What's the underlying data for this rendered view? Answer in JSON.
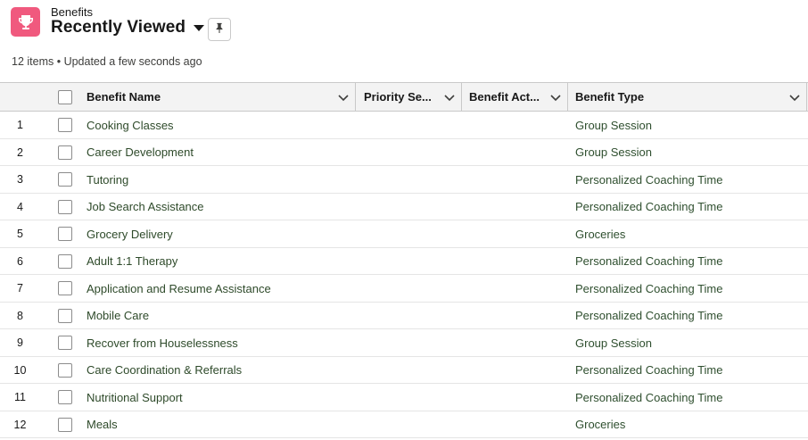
{
  "colors": {
    "icon_bg": "#f0597e",
    "header_bg": "#f3f3f3",
    "border": "#c9c9c9",
    "text_link": "#2e4a2a"
  },
  "header": {
    "object_label": "Benefits",
    "list_title": "Recently Viewed",
    "object_icon": "trophy-icon",
    "dropdown_icon": "caret-down-icon",
    "pin_icon": "pin-icon",
    "meta_text": "12 items • Updated a few seconds ago"
  },
  "table": {
    "columns": [
      {
        "label": "Benefit Name"
      },
      {
        "label": "Priority Se..."
      },
      {
        "label": "Benefit Act..."
      },
      {
        "label": "Benefit Type"
      }
    ],
    "rows": [
      {
        "num": "1",
        "name": "Cooking Classes",
        "type": "Group Session"
      },
      {
        "num": "2",
        "name": "Career Development",
        "type": "Group Session"
      },
      {
        "num": "3",
        "name": "Tutoring",
        "type": "Personalized Coaching Time"
      },
      {
        "num": "4",
        "name": "Job Search Assistance",
        "type": "Personalized Coaching Time"
      },
      {
        "num": "5",
        "name": "Grocery Delivery",
        "type": "Groceries"
      },
      {
        "num": "6",
        "name": "Adult 1:1 Therapy",
        "type": "Personalized Coaching Time"
      },
      {
        "num": "7",
        "name": "Application and Resume Assistance",
        "type": "Personalized Coaching Time"
      },
      {
        "num": "8",
        "name": "Mobile Care",
        "type": "Personalized Coaching Time"
      },
      {
        "num": "9",
        "name": "Recover from Houselessness",
        "type": "Group Session"
      },
      {
        "num": "10",
        "name": "Care Coordination & Referrals",
        "type": "Personalized Coaching Time"
      },
      {
        "num": "11",
        "name": "Nutritional Support",
        "type": "Personalized Coaching Time"
      },
      {
        "num": "12",
        "name": "Meals",
        "type": "Groceries"
      }
    ]
  }
}
